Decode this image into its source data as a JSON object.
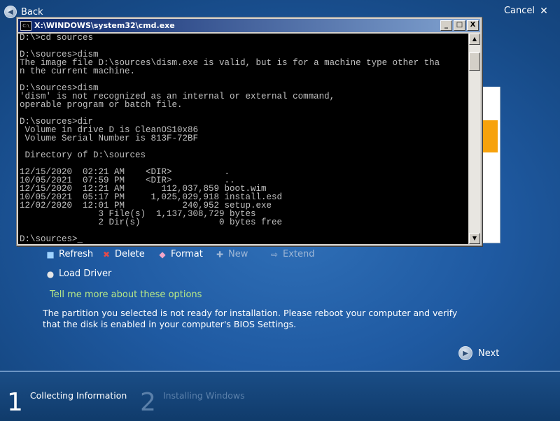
{
  "nav": {
    "back_label": "Back",
    "cancel_label": "Cancel"
  },
  "cmd_window": {
    "title": "X:\\WINDOWS\\system32\\cmd.exe",
    "icon_text": "C:\\",
    "buttons": {
      "minimize": "_",
      "maximize": "□",
      "close": "X"
    },
    "lines": [
      "D:\\>cd sources",
      "",
      "D:\\sources>dism",
      "The image file D:\\sources\\dism.exe is valid, but is for a machine type other tha",
      "n the current machine.",
      "",
      "D:\\sources>dism",
      "'dism' is not recognized as an internal or external command,",
      "operable program or batch file.",
      "",
      "D:\\sources>dir",
      " Volume in drive D is CleanOS10x86",
      " Volume Serial Number is 813F-72BF",
      "",
      " Directory of D:\\sources",
      "",
      "12/15/2020  02:21 AM    <DIR>          .",
      "10/05/2021  07:59 PM    <DIR>          ..",
      "12/15/2020  12:21 AM       112,037,859 boot.wim",
      "10/05/2021  05:17 PM     1,025,029,918 install.esd",
      "12/02/2020  12:01 PM           240,952 setup.exe",
      "               3 File(s)  1,137,308,729 bytes",
      "               2 Dir(s)               0 bytes free",
      "",
      "D:\\sources>_"
    ]
  },
  "toolbar": {
    "refresh": "Refresh",
    "delete": "Delete",
    "format": "Format",
    "new": "New",
    "extend": "Extend",
    "load_driver": "Load Driver"
  },
  "help_link": "Tell me more about these options",
  "message": "The partition you selected is not ready for installation. Please reboot your computer and verify that the disk is enabled in your computer's BIOS Settings.",
  "next_label": "Next",
  "steps": [
    {
      "num": "1",
      "label": "Collecting Information"
    },
    {
      "num": "2",
      "label": "Installing Windows"
    }
  ],
  "colors": {
    "accent_orange": "#f7a20c",
    "link_green": "#b8e986",
    "console_bg": "#000000",
    "console_text": "#c0c0c0"
  }
}
